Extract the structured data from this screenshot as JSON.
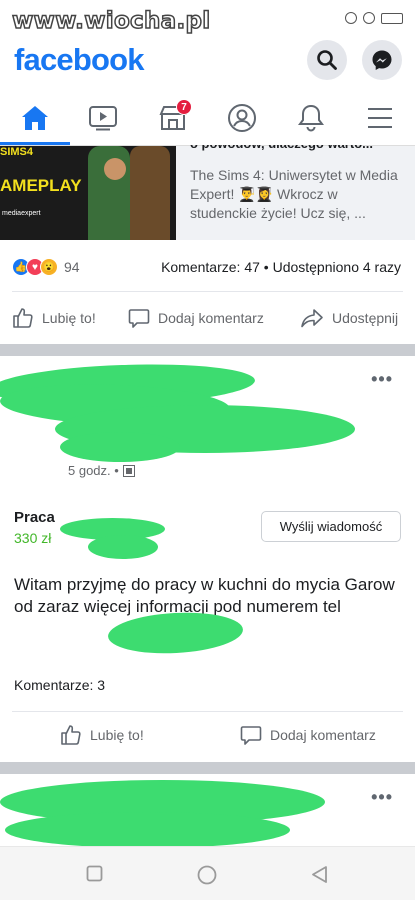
{
  "watermark": "www.wiocha.pl",
  "header": {
    "logo": "facebook",
    "brand_color": "#1877f2"
  },
  "nav": {
    "items": [
      "home-icon",
      "watch-icon",
      "marketplace-icon",
      "profile-icon",
      "notifications-icon",
      "menu-icon"
    ],
    "marketplace_badge": "7"
  },
  "ad": {
    "image_title": "AMEPLAY",
    "image_brand": "mediaexpert",
    "image_top_text": "SIMS4",
    "cut_title": "o powodów, dlaczego warto...",
    "description": "The Sims 4: Uniwersytet w Media Expert! 👨‍🎓👩‍🎓 Wkrocz w studenckie życie! Ucz się, ..."
  },
  "post1_stats": {
    "reaction_count": "94",
    "comments_shares": "Komentarze: 47 • Udostępniono 4 razy"
  },
  "post1_actions": {
    "like": "Lubię to!",
    "comment": "Dodaj komentarz",
    "share": "Udostępnij"
  },
  "post2": {
    "more": "•••",
    "time": "5 godz. •",
    "job_title": "Praca",
    "job_price": "330 zł",
    "message_button": "Wyślij wiadomość",
    "text": "Witam przyjmę do pracy w kuchni do mycia Garow od zaraz więcej informacji pod numerem tel",
    "comments": "Komentarze: 3",
    "like": "Lubię to!",
    "comment": "Dodaj komentarz"
  },
  "post3": {
    "more": "•••"
  },
  "colors": {
    "censor_green": "#3ddc70",
    "badge_red": "#e41e3f",
    "price_green": "#42b72a"
  }
}
